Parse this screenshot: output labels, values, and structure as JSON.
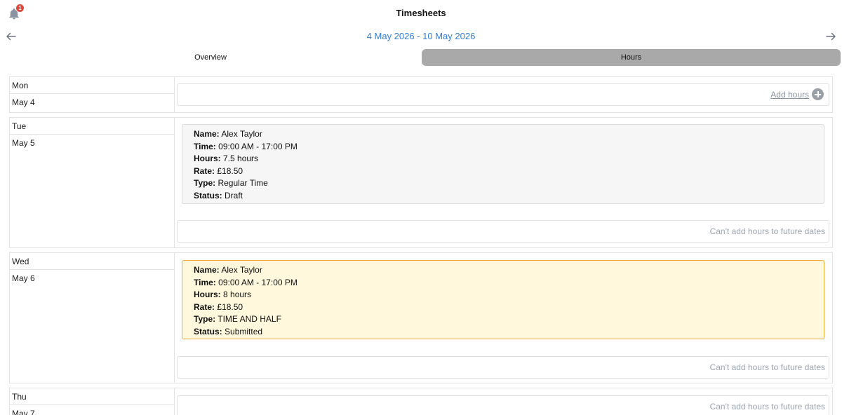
{
  "header": {
    "title": "Timesheets",
    "notification_count": "1",
    "date_range": "4 May 2026 - 10 May 2026"
  },
  "tabs": [
    {
      "label": "Overview",
      "active": false
    },
    {
      "label": "Hours",
      "active": true
    }
  ],
  "labels": {
    "name": "Name:",
    "time": "Time:",
    "hours": "Hours:",
    "rate": "Rate:",
    "type": "Type:",
    "status": "Status:",
    "add_hours": "Add hours",
    "future_notice": "Can't add hours to future dates"
  },
  "days": [
    {
      "name": "Mon",
      "date": "May 4"
    },
    {
      "name": "Tue",
      "date": "May 5",
      "entry": {
        "name": "Alex Taylor",
        "time": "09:00 AM - 17:00 PM",
        "hours": "7.5 hours",
        "rate": "£18.50",
        "type": "Regular Time",
        "status": "Draft"
      }
    },
    {
      "name": "Wed",
      "date": "May 6",
      "entry": {
        "name": "Alex Taylor",
        "time": "09:00 AM - 17:00 PM",
        "hours": "8 hours",
        "rate": "£18.50",
        "type": "TIME AND HALF",
        "status": "Submitted"
      }
    },
    {
      "name": "Thu",
      "date": "May 7"
    }
  ],
  "colors": {
    "accent": "#2f7fd8",
    "badge": "#e0463a",
    "submitted_bg": "#fff8dc",
    "submitted_border": "#f0a93a",
    "active_tab": "#a9a9a9"
  }
}
